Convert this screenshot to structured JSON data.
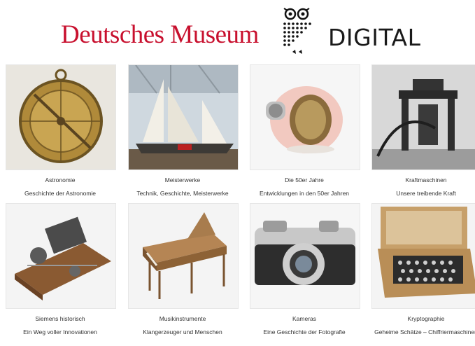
{
  "header": {
    "brand_name": "Deutsches Museum",
    "brand_suffix": "DIGITAL"
  },
  "tiles": [
    {
      "title": "Astronomie",
      "subtitle": "Geschichte der Astronomie",
      "image": "astrolabe"
    },
    {
      "title": "Meisterwerke",
      "subtitle": "Technik, Geschichte, Meisterwerke",
      "image": "sailing-boats"
    },
    {
      "title": "Die 50er Jahre",
      "subtitle": "Entwicklungen in den 50er Jahren",
      "image": "pink-heater"
    },
    {
      "title": "Kraftmaschinen",
      "subtitle": "Unsere treibende Kraft",
      "image": "steam-engine"
    },
    {
      "title": "Siemens historisch",
      "subtitle": "Ein Weg voller Innovationen",
      "image": "telegraph"
    },
    {
      "title": "Musikinstrumente",
      "subtitle": "Klangerzeuger und Menschen",
      "image": "harpsichord"
    },
    {
      "title": "Kameras",
      "subtitle": "Eine Geschichte der Fotografie",
      "image": "camera"
    },
    {
      "title": "Kryptographie",
      "subtitle": "Geheime Schätze – Chiffriermaschinen",
      "image": "enigma"
    }
  ]
}
